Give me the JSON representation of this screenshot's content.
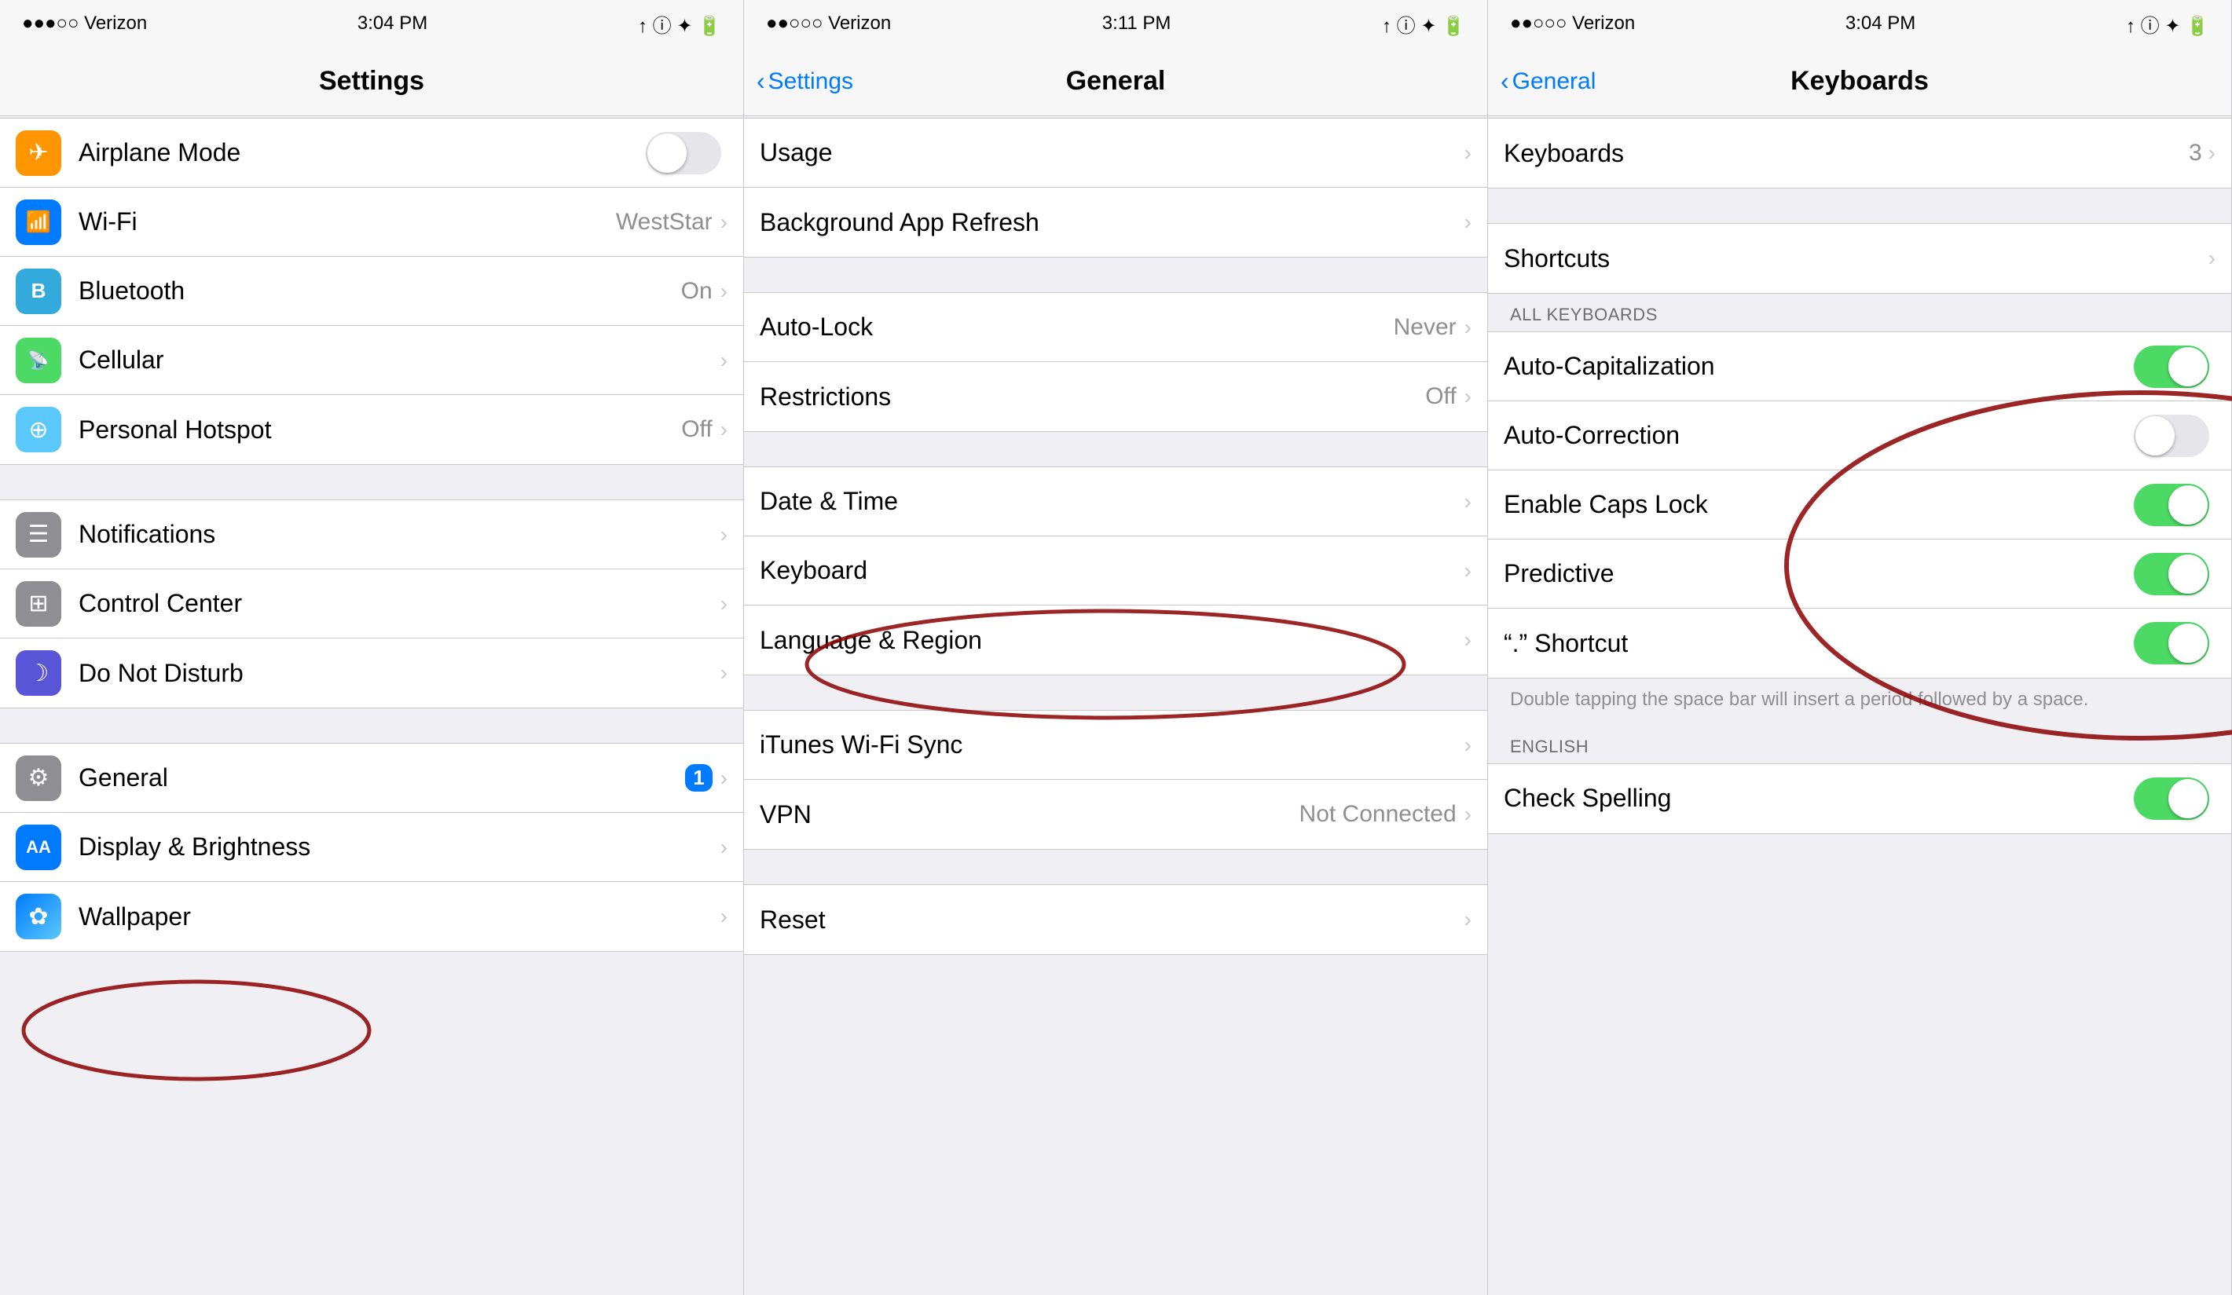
{
  "panel1": {
    "statusBar": {
      "carrier": "●●●○○ Verizon",
      "signal": "▼",
      "time": "3:04 PM",
      "icons": "↑ ⓘ ✦ 🔋"
    },
    "navBar": {
      "title": "Settings"
    },
    "rows": [
      {
        "id": "airplane",
        "label": "Airplane Mode",
        "iconBg": "icon-orange",
        "iconChar": "✈",
        "hasToggle": true,
        "toggleOn": false,
        "value": "",
        "hasChevron": false
      },
      {
        "id": "wifi",
        "label": "Wi-Fi",
        "iconBg": "icon-blue",
        "iconChar": "📶",
        "hasToggle": false,
        "value": "WestStar",
        "hasChevron": true
      },
      {
        "id": "bluetooth",
        "label": "Bluetooth",
        "iconBg": "icon-blue2",
        "iconChar": "✦",
        "hasToggle": false,
        "value": "On",
        "hasChevron": true
      },
      {
        "id": "cellular",
        "label": "Cellular",
        "iconBg": "icon-green",
        "iconChar": "⊕",
        "hasToggle": false,
        "value": "",
        "hasChevron": true
      },
      {
        "id": "hotspot",
        "label": "Personal Hotspot",
        "iconBg": "icon-green2",
        "iconChar": "⊕",
        "hasToggle": false,
        "value": "Off",
        "hasChevron": true
      }
    ],
    "rows2": [
      {
        "id": "notifications",
        "label": "Notifications",
        "iconBg": "icon-gray",
        "iconChar": "☰",
        "hasToggle": false,
        "value": "",
        "hasChevron": true
      },
      {
        "id": "control",
        "label": "Control Center",
        "iconBg": "icon-gray2",
        "iconChar": "⊞",
        "hasToggle": false,
        "value": "",
        "hasChevron": true
      },
      {
        "id": "dnd",
        "label": "Do Not Disturb",
        "iconBg": "icon-purple",
        "iconChar": "☽",
        "hasToggle": false,
        "value": "",
        "hasChevron": true
      }
    ],
    "rows3": [
      {
        "id": "general",
        "label": "General",
        "iconBg": "icon-darkgray",
        "iconChar": "⚙",
        "hasToggle": false,
        "value": "",
        "hasBadge": true,
        "badgeNum": "1",
        "hasChevron": true
      },
      {
        "id": "display",
        "label": "Display & Brightness",
        "iconBg": "icon-darkblue",
        "iconChar": "AA",
        "hasToggle": false,
        "value": "",
        "hasChevron": true
      },
      {
        "id": "wallpaper",
        "label": "Wallpaper",
        "iconBg": "icon-pink",
        "iconChar": "✿",
        "hasToggle": false,
        "value": "",
        "hasChevron": true
      }
    ]
  },
  "panel2": {
    "statusBar": {
      "carrier": "●●○○○ Verizon",
      "time": "3:11 PM"
    },
    "navBar": {
      "title": "General",
      "backLabel": "Settings"
    },
    "rows": [
      {
        "id": "usage",
        "label": "Usage",
        "value": "",
        "hasChevron": true
      },
      {
        "id": "bgrefresh",
        "label": "Background App Refresh",
        "value": "",
        "hasChevron": true
      }
    ],
    "rows2": [
      {
        "id": "autolock",
        "label": "Auto-Lock",
        "value": "Never",
        "hasChevron": true
      },
      {
        "id": "restrictions",
        "label": "Restrictions",
        "value": "Off",
        "hasChevron": true
      }
    ],
    "rows3": [
      {
        "id": "datetime",
        "label": "Date & Time",
        "value": "",
        "hasChevron": true
      },
      {
        "id": "keyboard",
        "label": "Keyboard",
        "value": "",
        "hasChevron": true
      },
      {
        "id": "language",
        "label": "Language & Region",
        "value": "",
        "hasChevron": true
      }
    ],
    "rows4": [
      {
        "id": "itunes",
        "label": "iTunes Wi-Fi Sync",
        "value": "",
        "hasChevron": true
      },
      {
        "id": "vpn",
        "label": "VPN",
        "value": "Not Connected",
        "hasChevron": true
      }
    ],
    "rows5": [
      {
        "id": "reset",
        "label": "Reset",
        "value": "",
        "hasChevron": true
      }
    ]
  },
  "panel3": {
    "statusBar": {
      "carrier": "●●○○○ Verizon",
      "time": "3:04 PM"
    },
    "navBar": {
      "title": "Keyboards",
      "backLabel": "General"
    },
    "keyboardsRow": {
      "label": "Keyboards",
      "value": "3",
      "hasChevron": true
    },
    "shortcutsRow": {
      "label": "Shortcuts",
      "hasChevron": true
    },
    "sectionHeader": "ALL KEYBOARDS",
    "toggleRows": [
      {
        "id": "autocap",
        "label": "Auto-Capitalization",
        "toggleOn": true
      },
      {
        "id": "autocorrect",
        "label": "Auto-Correction",
        "toggleOn": false
      },
      {
        "id": "capslock",
        "label": "Enable Caps Lock",
        "toggleOn": true
      },
      {
        "id": "predictive",
        "label": "Predictive",
        "toggleOn": true
      },
      {
        "id": "period",
        "label": "\".\" Shortcut",
        "toggleOn": true
      }
    ],
    "periodNote": "Double tapping the space bar will insert a period followed by a space.",
    "englishSection": "ENGLISH",
    "englishRows": [
      {
        "id": "spelling",
        "label": "Check Spelling",
        "toggleOn": true
      }
    ]
  },
  "circles": {
    "panel1_general": "circle around General row",
    "panel2_keyboard": "circle around Keyboard row",
    "panel3_toggles": "circle around Auto-Correction and surrounding"
  }
}
